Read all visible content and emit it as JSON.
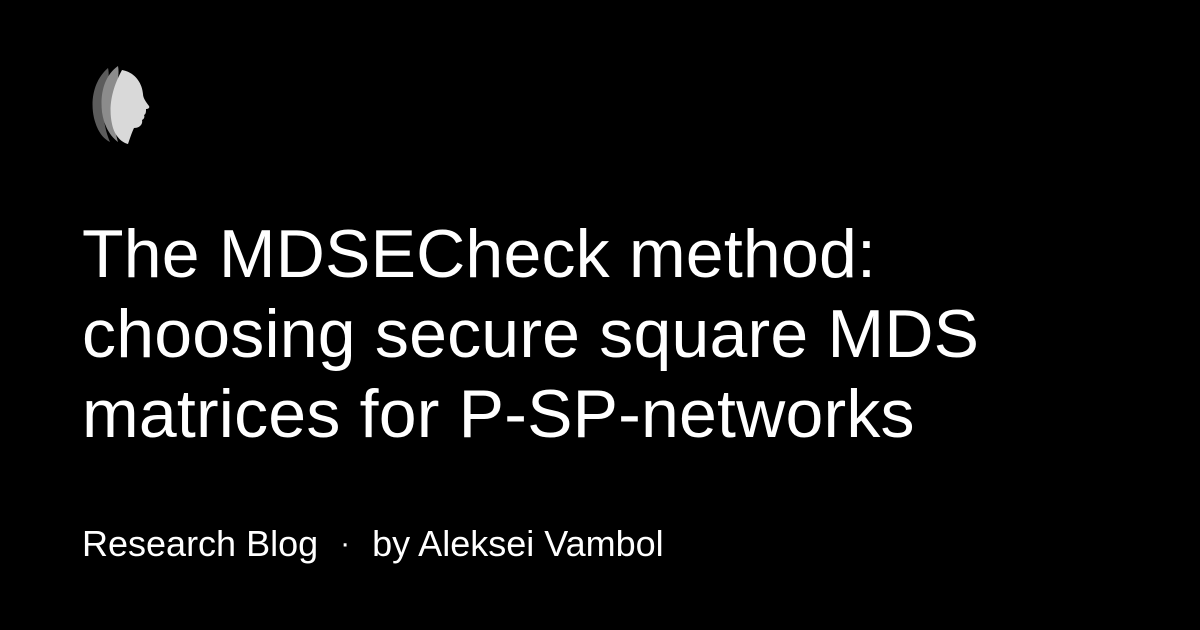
{
  "brand": {
    "logo_icon": "profile-silhouette-icon",
    "logo_colors": [
      "#5c5c5c",
      "#8c8c8c",
      "#d9d9d9"
    ]
  },
  "post": {
    "title_lines": [
      "The MDSECheck method:",
      "choosing secure square MDS",
      "matrices for P-SP-networks"
    ],
    "category": "Research Blog",
    "separator": "·",
    "byline": "by Aleksei Vambol"
  },
  "colors": {
    "background": "#000000",
    "text": "#ffffff"
  }
}
